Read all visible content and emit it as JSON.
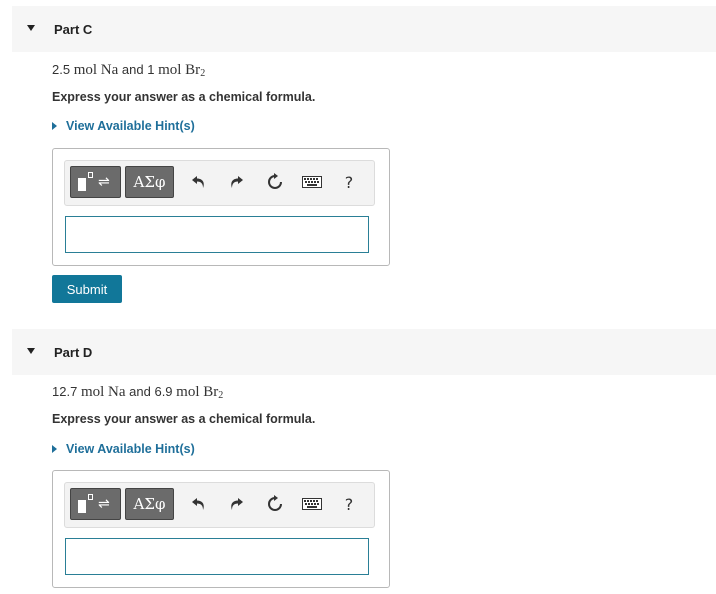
{
  "partC": {
    "title": "Part C",
    "amount1": "2.5",
    "unit1": "mol Na",
    "connector": "and",
    "amount2": "1",
    "unit2": "mol Br",
    "sub2": "2",
    "instruction": "Express your answer as a chemical formula.",
    "hint": "View Available Hint(s)",
    "input_value": "",
    "submit_label": "Submit"
  },
  "partD": {
    "title": "Part D",
    "amount1": "12.7",
    "unit1": "mol Na",
    "connector": "and",
    "amount2": "6.9",
    "unit2": "mol Br",
    "sub2": "2",
    "instruction": "Express your answer as a chemical formula.",
    "hint": "View Available Hint(s)",
    "input_value": ""
  },
  "toolbar": {
    "greek_label": "ΑΣφ",
    "help_label": "?",
    "icons": [
      "templates-icon",
      "greek-symbols-icon",
      "undo-icon",
      "redo-icon",
      "reset-icon",
      "keyboard-icon",
      "help-icon"
    ]
  },
  "colors": {
    "accent": "#117799",
    "link": "#1f6f9a",
    "header_bg": "#f6f6f6"
  }
}
